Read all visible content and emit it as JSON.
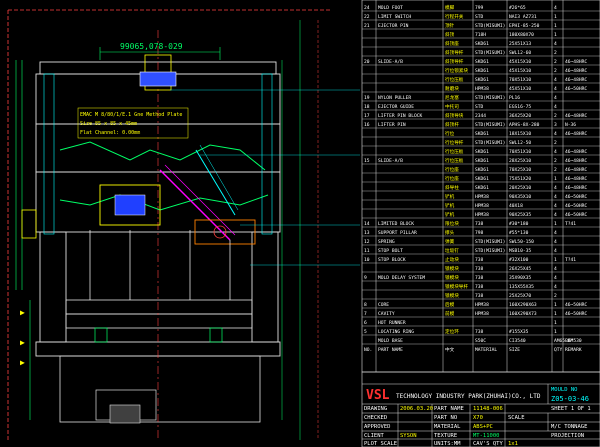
{
  "drawing": {
    "dimension_label": "99065,078-029",
    "note_lines": [
      "EMAC M 8/80/1/E.1 Gne Method Plate",
      "Size 85 x 85 x 45mm",
      "Flat Channel: 0.00mm"
    ]
  },
  "bom_rows": [
    {
      "no": "24",
      "desc": "MOLD FOOT",
      "zh": "模脚",
      "mat": "799",
      "size": "#26*65",
      "qty": "4",
      "rem": ""
    },
    {
      "no": "22",
      "desc": "LIMIT SWITCH",
      "zh": "行程开关",
      "mat": "STD",
      "size": "NAI3 AZ731",
      "qty": "1",
      "rem": ""
    },
    {
      "no": "21",
      "desc": "EJECTOR PIN",
      "zh": "顶针",
      "mat": "STD(MISUMI)",
      "size": "EPHI-85-250",
      "qty": "1",
      "rem": ""
    },
    {
      "no": "",
      "desc": "",
      "zh": "斜顶",
      "mat": "718H",
      "size": "180X80X70",
      "qty": "1",
      "rem": ""
    },
    {
      "no": "",
      "desc": "",
      "zh": "斜顶座",
      "mat": "SKD61",
      "size": "25X51X13",
      "qty": "4",
      "rem": ""
    },
    {
      "no": "",
      "desc": "",
      "zh": "斜顶导杆",
      "mat": "STD(MISUMI)",
      "size": "SWL12-60",
      "qty": "2",
      "rem": ""
    },
    {
      "no": "20",
      "desc": "SLIDE-A/B",
      "zh": "斜顶导杆",
      "mat": "SKD61",
      "size": "45X15X10",
      "qty": "2",
      "rem": "46~48HRC"
    },
    {
      "no": "",
      "desc": "",
      "zh": "行位锁紧块",
      "mat": "SKD61",
      "size": "45X15X10",
      "qty": "2",
      "rem": "46~48HRC"
    },
    {
      "no": "",
      "desc": "",
      "zh": "行位压板",
      "mat": "SKD61",
      "size": "70X51X10",
      "qty": "4",
      "rem": "46~48HRC"
    },
    {
      "no": "",
      "desc": "",
      "zh": "耐磨块",
      "mat": "HPM38",
      "size": "45X51X10",
      "qty": "4",
      "rem": "46~50HRC"
    },
    {
      "no": "19",
      "desc": "NYLON PULLER",
      "zh": "尼龙塞",
      "mat": "STD(MISUMI)",
      "size": "PL16",
      "qty": "4",
      "rem": ""
    },
    {
      "no": "18",
      "desc": "EJECTOR GUIDE",
      "zh": "中托司",
      "mat": "STD",
      "size": "EGS16-75",
      "qty": "4",
      "rem": ""
    },
    {
      "no": "17",
      "desc": "LIFTER PIN BLOCK",
      "zh": "斜顶导块",
      "mat": "2344",
      "size": "36X25X20",
      "qty": "2",
      "rem": "46~48HRC"
    },
    {
      "no": "16",
      "desc": "LIFTER PIN",
      "zh": "斜顶杆",
      "mat": "STD(MISUMI)",
      "size": "APHS-8X-280",
      "qty": "3",
      "rem": "N-36"
    },
    {
      "no": "",
      "desc": "",
      "zh": "行位",
      "mat": "SKD61",
      "size": "18X15X10",
      "qty": "4",
      "rem": "46~48HRC"
    },
    {
      "no": "",
      "desc": "",
      "zh": "行位导杆",
      "mat": "STD(MISUMI)",
      "size": "SWL12-50",
      "qty": "2",
      "rem": ""
    },
    {
      "no": "",
      "desc": "",
      "zh": "行位压板",
      "mat": "SKD61",
      "size": "70X51X10",
      "qty": "4",
      "rem": "46~48HRC"
    },
    {
      "no": "15",
      "desc": "SLIDE-A/B",
      "zh": "行位压板",
      "mat": "SKD61",
      "size": "28X25X10",
      "qty": "2",
      "rem": "46~48HRC"
    },
    {
      "no": "",
      "desc": "",
      "zh": "行位座",
      "mat": "SKD61",
      "size": "70X25X10",
      "qty": "2",
      "rem": "46~48HRC"
    },
    {
      "no": "",
      "desc": "",
      "zh": "行位座",
      "mat": "SKD61",
      "size": "75X51X20",
      "qty": "1",
      "rem": "46~48HRC"
    },
    {
      "no": "",
      "desc": "",
      "zh": "斜导柱",
      "mat": "SKD61",
      "size": "20X25X10",
      "qty": "4",
      "rem": "46~48HRC"
    },
    {
      "no": "",
      "desc": "",
      "zh": "铲机",
      "mat": "HPM38",
      "size": "90X35X10",
      "qty": "4",
      "rem": "46~50HRC"
    },
    {
      "no": "",
      "desc": "",
      "zh": "铲机",
      "mat": "HPM38",
      "size": "40X18",
      "qty": "4",
      "rem": "46~50HRC"
    },
    {
      "no": "",
      "desc": "",
      "zh": "铲机",
      "mat": "HPM38",
      "size": "90X25X35",
      "qty": "4",
      "rem": "46~50HRC"
    },
    {
      "no": "14",
      "desc": "LIMITED BLOCK",
      "zh": "限位块",
      "mat": "738",
      "size": "#30*180",
      "qty": "1",
      "rem": "T?41"
    },
    {
      "no": "13",
      "desc": "SUPPORT PILLAR",
      "zh": "撑头",
      "mat": "798",
      "size": "#55*130",
      "qty": "4",
      "rem": ""
    },
    {
      "no": "12",
      "desc": "SPRING",
      "zh": "弹簧",
      "mat": "STD(MISUMI)",
      "size": "SWL50-150",
      "qty": "4",
      "rem": ""
    },
    {
      "no": "11",
      "desc": "STOP BOLT",
      "zh": "垃圾钉",
      "mat": "STD(MISUMI)",
      "size": "MSB10-35",
      "qty": "4",
      "rem": ""
    },
    {
      "no": "10",
      "desc": "STOP BLOCK",
      "zh": "止动块",
      "mat": "738",
      "size": "#32X100",
      "qty": "1",
      "rem": "T?41"
    },
    {
      "no": "",
      "desc": "",
      "zh": "锁模块",
      "mat": "738",
      "size": "26X25X45",
      "qty": "4",
      "rem": ""
    },
    {
      "no": "9",
      "desc": "MOLD DELAY SYSTEM",
      "zh": "锁模块",
      "mat": "738",
      "size": "35X90X35",
      "qty": "4",
      "rem": ""
    },
    {
      "no": "",
      "desc": "",
      "zh": "锁模块导杆",
      "mat": "738",
      "size": "135X55X35",
      "qty": "4",
      "rem": ""
    },
    {
      "no": "",
      "desc": "",
      "zh": "锁模块",
      "mat": "738",
      "size": "25X25X70",
      "qty": "2",
      "rem": ""
    },
    {
      "no": "8",
      "desc": "CORE",
      "zh": "后模",
      "mat": "HPM38",
      "size": "160X290X63",
      "qty": "1",
      "rem": "46~50HRC"
    },
    {
      "no": "7",
      "desc": "CAVITY",
      "zh": "前模",
      "mat": "HPM38",
      "size": "160X290X73",
      "qty": "1",
      "rem": "46~50HRC"
    },
    {
      "no": "6",
      "desc": "HOT RUNNER",
      "zh": "",
      "mat": "",
      "size": "",
      "qty": "1",
      "rem": ""
    },
    {
      "no": "5",
      "desc": "LOCATING RING",
      "zh": "定位环",
      "mat": "738",
      "size": "#155X35",
      "qty": "1",
      "rem": ""
    },
    {
      "no": "",
      "desc": "MOLD BASE",
      "zh": "",
      "mat": "S50C",
      "size": "CI3540",
      "qty": "AM65B6*530",
      "rem": "LKM"
    }
  ],
  "header_row": {
    "no": "NO.",
    "part": "PART NAME",
    "zh": "中文",
    "mat": "MATERIAL",
    "size": "SIZE",
    "qty": "QTY",
    "rem": "REMARK"
  },
  "title_block": {
    "company": "TECHNOLOGY INDUSTRY PARK(ZHUHAI)CO., LTD",
    "logo": "VSL",
    "mould_no_label": "MOULD NO",
    "mould_no": "Z05-03-46",
    "drawing_label": "DRAWING",
    "date": "2006.03.20",
    "part_name_label": "PART NAME",
    "part_name": "11148-006",
    "sheet": "SHEET 1 OF 1",
    "checked_label": "CHECKED",
    "part_no_label": "PART NO",
    "part_no": "X70",
    "scale_label": "SCALE",
    "approved_label": "APPROVED",
    "material_label": "MATERIAL",
    "material": "ABS+PC",
    "mc_label": "M/C TONNAGE",
    "client_label": "CLIENT",
    "client": "SYSON",
    "texture_label": "TEXTURE",
    "texture": "MT-11000",
    "projection_label": "PROJECTION",
    "plot_scale_label": "PLOT SCALE",
    "units": "UNITS:MM",
    "cav_label": "CAV'S QTY",
    "cav": "1x1"
  }
}
